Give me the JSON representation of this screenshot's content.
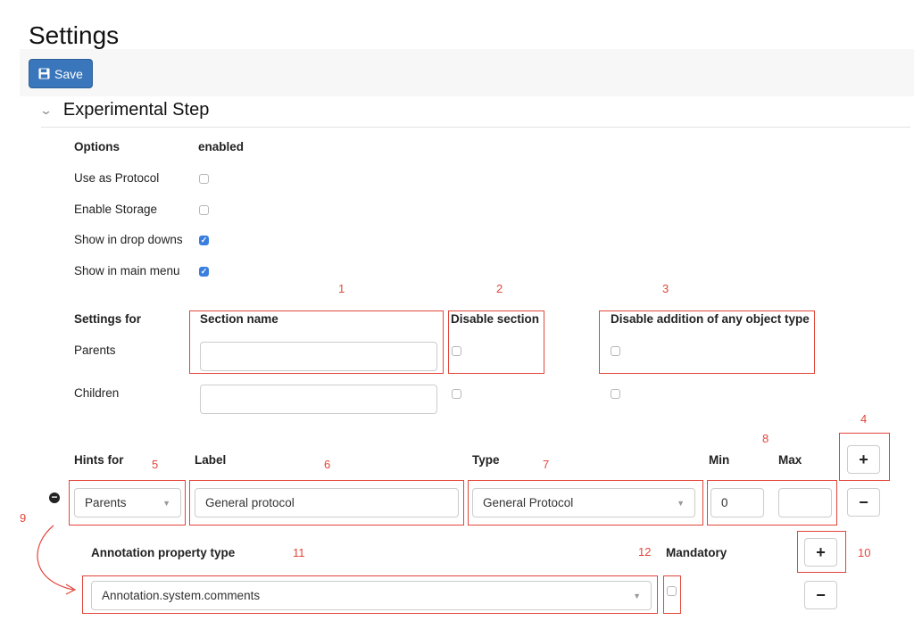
{
  "page": {
    "title": "Settings",
    "save_label": "Save"
  },
  "section": {
    "title": "Experimental Step"
  },
  "options": {
    "header_label": "Options",
    "header_value": "enabled",
    "rows": [
      {
        "label": "Use as Protocol",
        "checked": false
      },
      {
        "label": "Enable Storage",
        "checked": false
      },
      {
        "label": "Show in drop downs",
        "checked": true
      },
      {
        "label": "Show in main menu",
        "checked": true
      }
    ]
  },
  "settings_table": {
    "headers": {
      "settings_for": "Settings for",
      "section_name": "Section name",
      "disable_section": "Disable section",
      "disable_addition": "Disable addition of any object type"
    },
    "rows": [
      {
        "label": "Parents",
        "section_name": "",
        "disable_section": false,
        "disable_addition": false
      },
      {
        "label": "Children",
        "section_name": "",
        "disable_section": false,
        "disable_addition": false
      }
    ]
  },
  "hints": {
    "headers": {
      "hints_for": "Hints for",
      "label": "Label",
      "type": "Type",
      "min": "Min",
      "max": "Max"
    },
    "row": {
      "hints_for": "Parents",
      "label": "General protocol",
      "type": "General Protocol",
      "min": "0",
      "max": ""
    },
    "add_symbol": "+",
    "remove_symbol": "−",
    "annotation": {
      "type_label": "Annotation property type",
      "mandatory_label": "Mandatory",
      "value": "Annotation.system.comments",
      "mandatory": false,
      "add_symbol": "+",
      "remove_symbol": "−"
    }
  },
  "annotations": {
    "n1": "1",
    "n2": "2",
    "n3": "3",
    "n4": "4",
    "n5": "5",
    "n6": "6",
    "n7": "7",
    "n8": "8",
    "n9": "9",
    "n10": "10",
    "n11": "11",
    "n12": "12",
    "color": "#e2453a"
  },
  "colors": {
    "primary": "#3a76bb",
    "checkbox_checked": "#3a7ee0",
    "annotation_red": "#e2453a"
  },
  "icons": {
    "save": "floppy-disk-icon",
    "section_toggle": "chevron-down-icon",
    "remove_row": "minus-circle-icon",
    "select_caret": "caret-down-icon"
  }
}
